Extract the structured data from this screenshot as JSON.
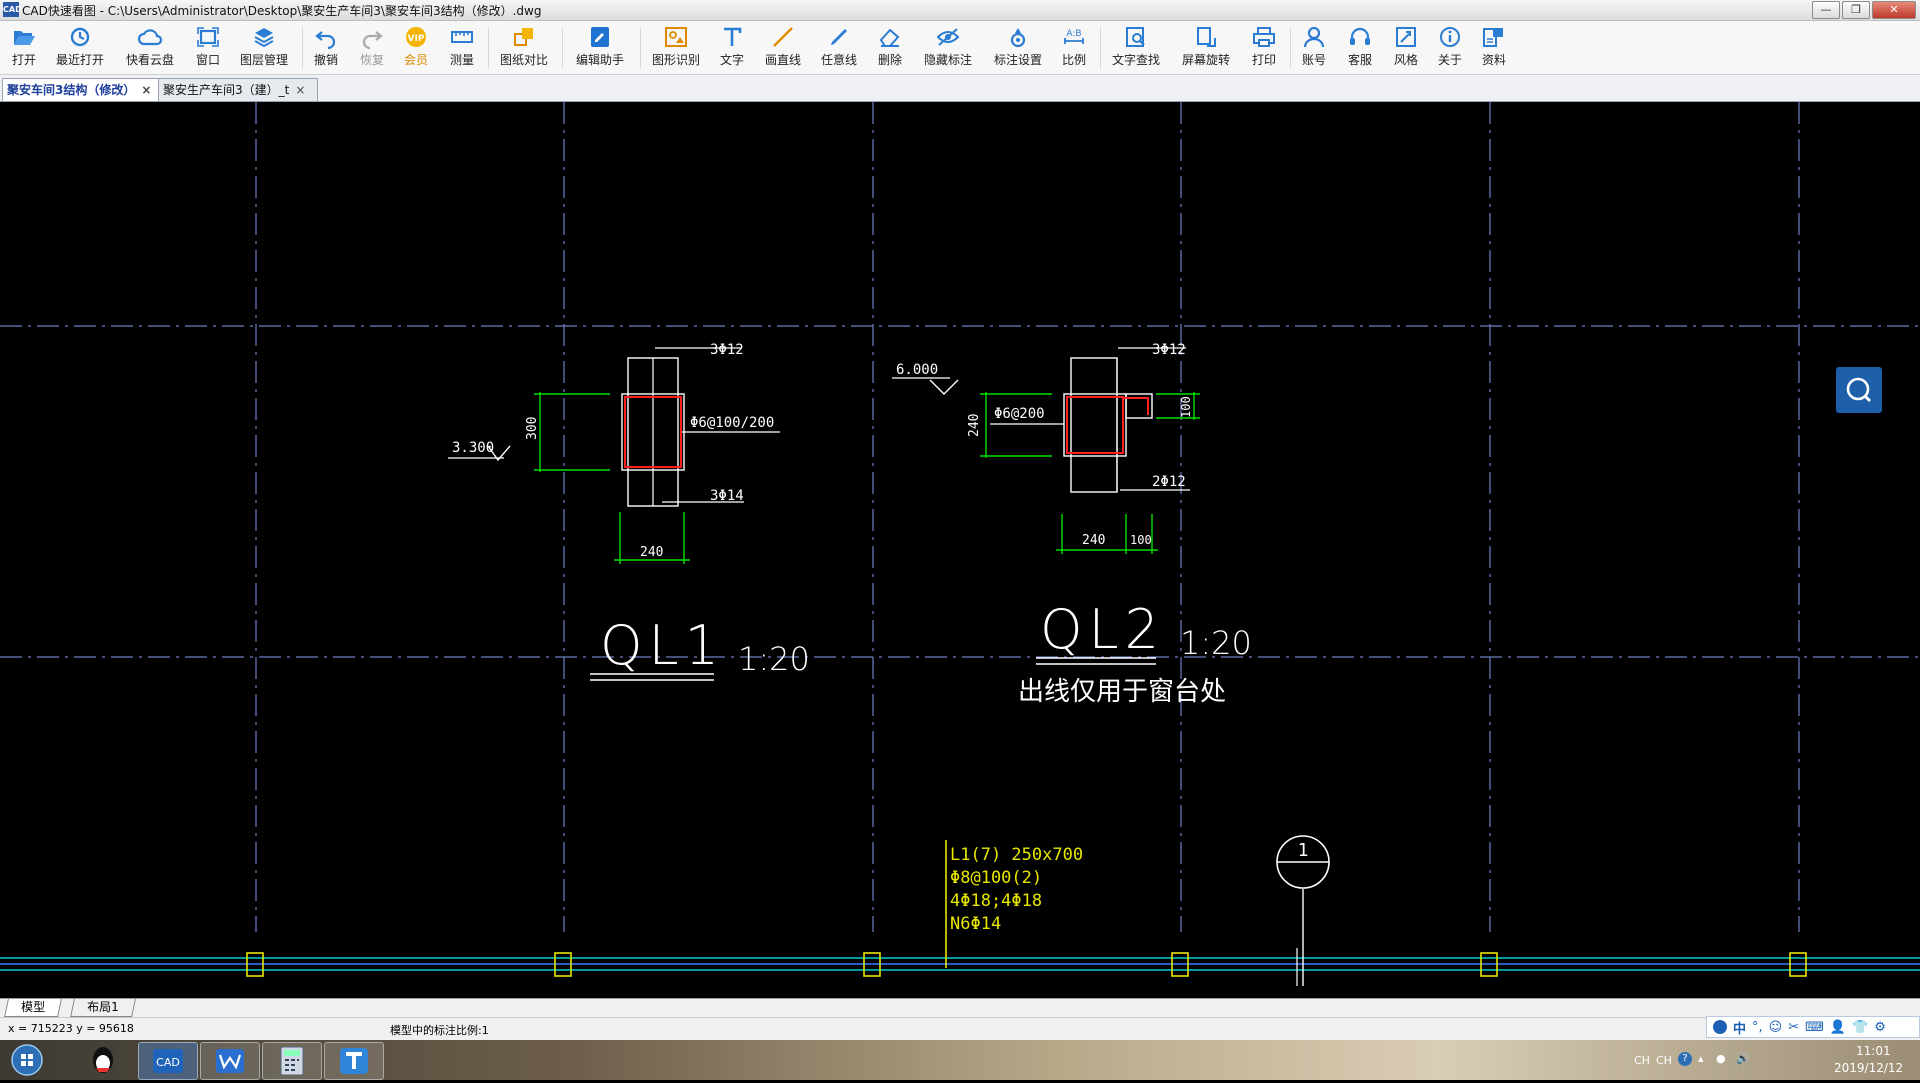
{
  "window": {
    "app_icon_text": "CAD",
    "title": "CAD快速看图 - C:\\Users\\Administrator\\Desktop\\聚安生产车间3\\聚安车间3结构（修改）.dwg",
    "controls": [
      "—",
      "❐",
      "✕"
    ]
  },
  "toolbar": {
    "buttons": [
      {
        "label": "打开",
        "icon": "folder-open-icon"
      },
      {
        "label": "最近打开",
        "icon": "history-icon"
      },
      {
        "label": "快看云盘",
        "icon": "cloud-icon"
      },
      {
        "label": "窗口",
        "icon": "window-icon"
      },
      {
        "label": "图层管理",
        "icon": "layers-icon"
      },
      {
        "label": "撤销",
        "icon": "undo-icon"
      },
      {
        "label": "恢复",
        "icon": "redo-icon"
      },
      {
        "label": "会员",
        "icon": "vip-icon"
      },
      {
        "label": "测量",
        "icon": "ruler-icon"
      },
      {
        "label": "图纸对比",
        "icon": "compare-icon"
      },
      {
        "label": "编辑助手",
        "icon": "edit-assistant-icon"
      },
      {
        "label": "图形识别",
        "icon": "shape-recognition-icon"
      },
      {
        "label": "文字",
        "icon": "text-icon"
      },
      {
        "label": "画直线",
        "icon": "line-icon"
      },
      {
        "label": "任意线",
        "icon": "freehand-icon"
      },
      {
        "label": "删除",
        "icon": "eraser-icon"
      },
      {
        "label": "隐藏标注",
        "icon": "hide-annotation-icon"
      },
      {
        "label": "标注设置",
        "icon": "annotation-settings-icon"
      },
      {
        "label": "比例",
        "icon": "scale-icon"
      },
      {
        "label": "文字查找",
        "icon": "text-search-icon"
      },
      {
        "label": "屏幕旋转",
        "icon": "rotate-screen-icon"
      },
      {
        "label": "打印",
        "icon": "printer-icon"
      },
      {
        "label": "账号",
        "icon": "account-icon"
      },
      {
        "label": "客服",
        "icon": "headset-icon"
      },
      {
        "label": "风格",
        "icon": "style-icon"
      },
      {
        "label": "关于",
        "icon": "info-icon"
      },
      {
        "label": "资料",
        "icon": "library-icon"
      }
    ],
    "vip_text": "VIP"
  },
  "tabs": [
    {
      "label": "聚安车间3结构（修改）",
      "active": true
    },
    {
      "label": "聚安生产车间3（建）_t",
      "active": false
    }
  ],
  "tab_close": "×",
  "drawing": {
    "ql1": {
      "title": "QL1",
      "scale": "1:20",
      "top_rebar": "3Φ12",
      "stirrup": "Φ6@100/200",
      "bottom_rebar": "3Φ14",
      "height_dim": "300",
      "width_dim": "240",
      "elevation": "3.300"
    },
    "ql2": {
      "title": "QL2",
      "scale": "1:20",
      "note": "出线仅用于窗台处",
      "top_rebar": "3Φ12",
      "stirrup": "Φ6@200",
      "bottom_rebar": "2Φ12",
      "height_dim": "240",
      "ledge_dim": "100",
      "width_dim": "240",
      "ledge_width_dim": "100",
      "elevation": "6.000"
    },
    "beam_label": [
      "L1(7) 250x700",
      "Φ8@100(2)",
      "4Φ18;4Φ18",
      "N6Φ14"
    ],
    "axis_bubble": "1"
  },
  "colors": {
    "grid": "#6d7fc4",
    "dims": "#00e000",
    "section": "#ff2020",
    "label": "#e6e600",
    "line": "#ffffff",
    "beam": "#00d0d0"
  },
  "layout_tabs": [
    "模型",
    "布局1"
  ],
  "status": {
    "coords": "x = 715223  y = 95618",
    "scale_text": "模型中的标注比例:1"
  },
  "ime": {
    "label": "中"
  },
  "taskbar": {
    "apps": [
      "start-orb",
      "qq",
      "cad",
      "wps",
      "calculator",
      "tool"
    ]
  },
  "tray": {
    "lang1": "CH",
    "lang2": "CH",
    "time": "11:01",
    "date": "2019/12/12"
  }
}
